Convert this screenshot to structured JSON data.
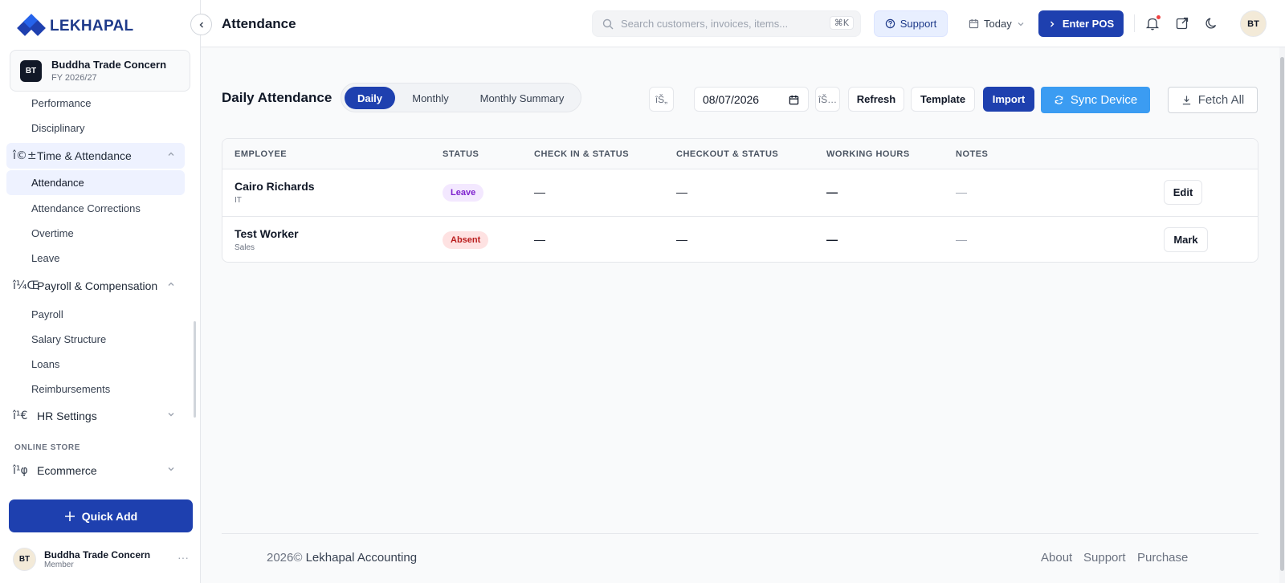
{
  "brand": {
    "name": "LEKHAPAL",
    "color": "#1e40af"
  },
  "org": {
    "initials": "BT",
    "name": "Buddha Trade Concern",
    "fiscal_year": "FY 2026/27"
  },
  "sidebar": {
    "items": [
      {
        "type": "sub",
        "label": "Performance"
      },
      {
        "type": "sub",
        "label": "Disciplinary"
      },
      {
        "type": "group",
        "icon": "î©±",
        "label": "Time & Attendance",
        "open": true
      },
      {
        "type": "sub",
        "label": "Attendance",
        "active": true
      },
      {
        "type": "sub",
        "label": "Attendance Corrections"
      },
      {
        "type": "sub",
        "label": "Overtime"
      },
      {
        "type": "sub",
        "label": "Leave"
      },
      {
        "type": "group",
        "icon": "î¼Œ",
        "label": "Payroll & Compensation",
        "open": true
      },
      {
        "type": "sub",
        "label": "Payroll"
      },
      {
        "type": "sub",
        "label": "Salary Structure"
      },
      {
        "type": "sub",
        "label": "Loans"
      },
      {
        "type": "sub",
        "label": "Reimbursements"
      },
      {
        "type": "group",
        "icon": "î¹€",
        "label": "HR Settings",
        "open": false
      },
      {
        "type": "section",
        "label": "ONLINE STORE"
      },
      {
        "type": "group",
        "icon": "î¹φ",
        "label": "Ecommerce",
        "open": false
      }
    ],
    "quick_add": "Quick Add",
    "user": {
      "initials": "BT",
      "name": "Buddha Trade Concern",
      "role": "Member",
      "more": "···"
    }
  },
  "header": {
    "title": "Attendance",
    "search_placeholder": "Search customers, invoices, items...",
    "search_shortcut": "⌘K",
    "support": "Support",
    "date_range": "Today",
    "enter_pos": "Enter POS",
    "avatar": "BT"
  },
  "main": {
    "section_title": "Daily Attendance",
    "tabs": [
      {
        "label": "Daily",
        "active": true
      },
      {
        "label": "Monthly",
        "active": false
      },
      {
        "label": "Monthly Summary",
        "active": false
      }
    ],
    "prev_glyph": "îŠ„",
    "next_glyph": "îŠ…",
    "date": "08/07/2026",
    "buttons": {
      "refresh": "Refresh",
      "template": "Template",
      "import": "Import",
      "sync": "Sync Device",
      "fetch_all": "Fetch All"
    },
    "sync_color": "#3b9cf2",
    "table": {
      "columns": [
        "EMPLOYEE",
        "STATUS",
        "CHECK IN & STATUS",
        "CHECKOUT & STATUS",
        "WORKING HOURS",
        "NOTES"
      ],
      "rows": [
        {
          "name": "Cairo Richards",
          "dept": "IT",
          "status": "Leave",
          "check_in": "—",
          "checkout": "—",
          "hours": "—",
          "notes": "—",
          "action": "Edit"
        },
        {
          "name": "Test Worker",
          "dept": "Sales",
          "status": "Absent",
          "check_in": "—",
          "checkout": "—",
          "hours": "—",
          "notes": "—",
          "action": "Mark"
        }
      ]
    }
  },
  "footer": {
    "year": "2026©",
    "company": "Lekhapal Accounting",
    "links": [
      "About",
      "Support",
      "Purchase"
    ]
  }
}
